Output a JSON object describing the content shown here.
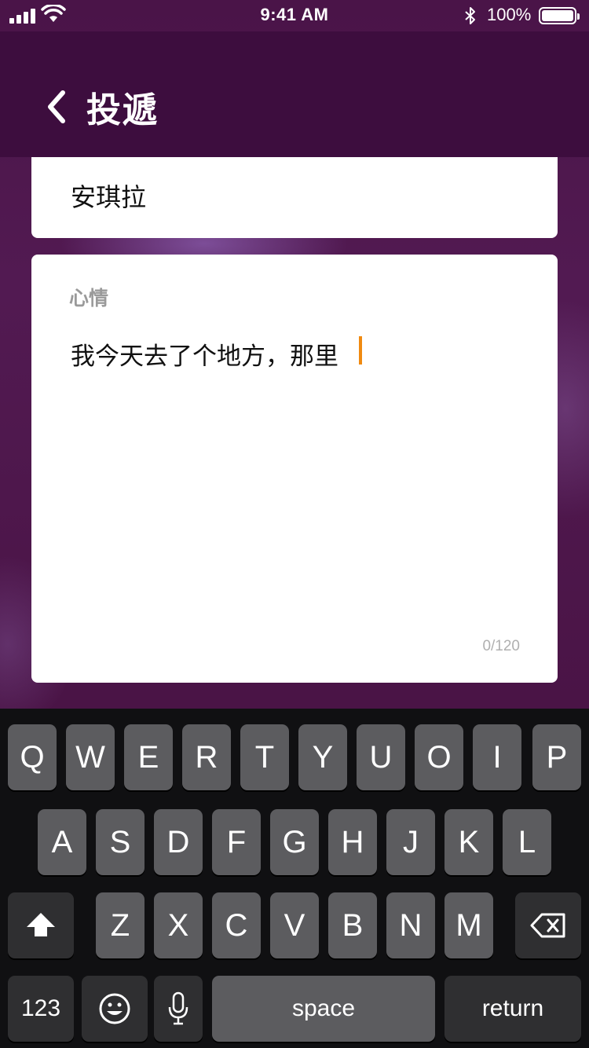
{
  "status_bar": {
    "time": "9:41 AM",
    "battery": "100%"
  },
  "nav": {
    "title": "投遞"
  },
  "name_card": {
    "name": "安琪拉"
  },
  "mood_card": {
    "label": "心情",
    "text": "我今天去了个地方，那里",
    "counter": "0/120"
  },
  "keyboard": {
    "row1": [
      "Q",
      "W",
      "E",
      "R",
      "T",
      "Y",
      "U",
      "O",
      "I",
      "P"
    ],
    "row2": [
      "A",
      "S",
      "D",
      "F",
      "G",
      "H",
      "J",
      "K",
      "L"
    ],
    "row3": [
      "Z",
      "X",
      "C",
      "V",
      "B",
      "N",
      "M"
    ],
    "numbers_label": "123",
    "space_label": "space",
    "return_label": "return"
  },
  "colors": {
    "nav_bg": "#3d0d3e",
    "cursor": "#f08a10",
    "keyboard_bg": "#101012"
  },
  "icons": [
    "signal-icon",
    "wifi-icon",
    "bluetooth-icon",
    "battery-icon",
    "back-chevron-icon",
    "shift-icon",
    "delete-icon",
    "emoji-icon",
    "microphone-icon"
  ]
}
